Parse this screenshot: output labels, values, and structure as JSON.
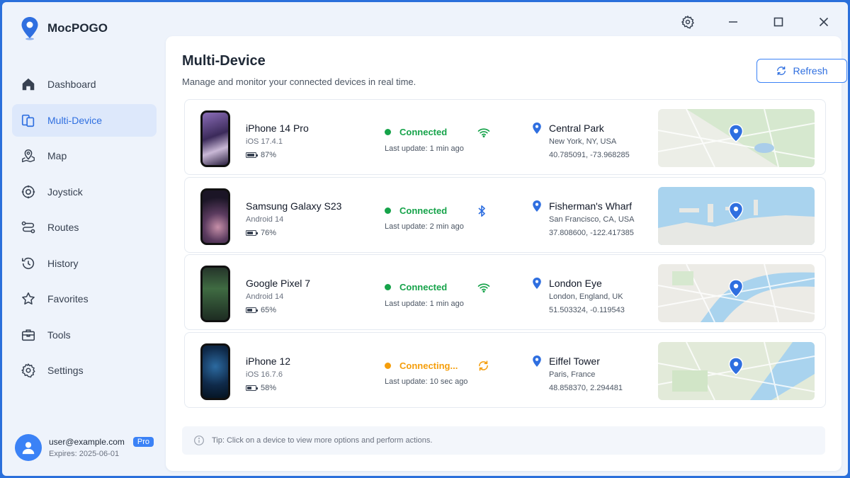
{
  "app": {
    "name": "MocPOGO"
  },
  "nav": [
    {
      "label": "Dashboard",
      "icon": "home-icon",
      "active": false
    },
    {
      "label": "Multi-Device",
      "icon": "multi-device-icon",
      "active": true
    },
    {
      "label": "Map",
      "icon": "map-icon",
      "active": false
    },
    {
      "label": "Joystick",
      "icon": "joystick-icon",
      "active": false
    },
    {
      "label": "Routes",
      "icon": "routes-icon",
      "active": false
    },
    {
      "label": "History",
      "icon": "history-icon",
      "active": false
    },
    {
      "label": "Favorites",
      "icon": "star-icon",
      "active": false
    },
    {
      "label": "Tools",
      "icon": "toolbox-icon",
      "active": false
    },
    {
      "label": "Settings",
      "icon": "gear-icon",
      "active": false
    }
  ],
  "user": {
    "email": "user@example.com",
    "badge": "Pro",
    "expires": "Expires: 2025-06-01"
  },
  "main": {
    "title": "Multi-Device",
    "subtitle": "Manage and monitor your connected devices in real time.",
    "refresh_label": "Refresh"
  },
  "devices": [
    {
      "name": "iPhone 14 Pro",
      "os": "iOS 17.4.1",
      "battery": "87%",
      "battery_level": 0.87,
      "status": "Connected",
      "status_color": "#16a34a",
      "connection_icon": "wifi-icon",
      "last_update": "Last update: 1 min ago",
      "location": "Central Park",
      "city": "New York, NY, USA",
      "coords": "40.785091, -73.968285",
      "map_style": "park"
    },
    {
      "name": "Samsung Galaxy S23",
      "os": "Android 14",
      "battery": "76%",
      "battery_level": 0.76,
      "status": "Connected",
      "status_color": "#16a34a",
      "connection_icon": "bluetooth-icon",
      "last_update": "Last update: 2 min ago",
      "location": "Fisherman's Wharf",
      "city": "San Francisco, CA, USA",
      "coords": "37.808600, -122.417385",
      "map_style": "harbor"
    },
    {
      "name": "Google Pixel 7",
      "os": "Android 14",
      "battery": "65%",
      "battery_level": 0.65,
      "status": "Connected",
      "status_color": "#16a34a",
      "connection_icon": "wifi-icon",
      "last_update": "Last update: 1 min ago",
      "location": "London Eye",
      "city": "London, England, UK",
      "coords": "51.503324, -0.119543",
      "map_style": "river"
    },
    {
      "name": "iPhone 12",
      "os": "iOS 16.7.6",
      "battery": "58%",
      "battery_level": 0.58,
      "status": "Connecting...",
      "status_color": "#f59e0b",
      "connection_icon": "sync-icon",
      "last_update": "Last update: 10 sec ago",
      "location": "Eiffel Tower",
      "city": "Paris, France",
      "coords": "48.858370, 2.294481",
      "map_style": "seine"
    }
  ],
  "tip": "Tip: Click on a device to view more options and perform actions.",
  "colors": {
    "accent": "#3b82f6",
    "connected": "#16a34a",
    "connecting": "#f59e0b"
  }
}
